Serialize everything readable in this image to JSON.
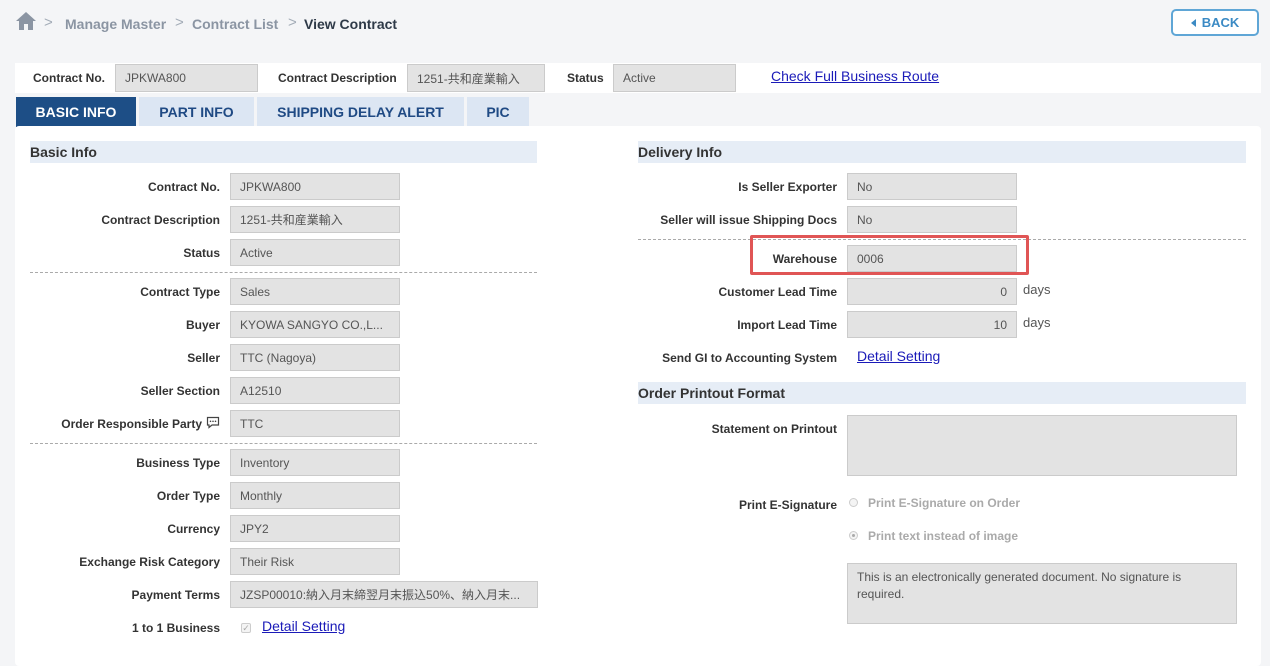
{
  "breadcrumb": {
    "items": [
      "Manage Master",
      "Contract List"
    ],
    "current": "View Contract",
    "separator": ">"
  },
  "back_button": "BACK",
  "header": {
    "contract_no_label": "Contract No.",
    "contract_no": "JPKWA800",
    "contract_desc_label": "Contract Description",
    "contract_desc": "1251-共和産業輸入",
    "status_label": "Status",
    "status": "Active",
    "route_link": "Check Full Business Route"
  },
  "tabs": [
    "BASIC INFO",
    "PART INFO",
    "SHIPPING DELAY ALERT",
    "PIC"
  ],
  "basic_info": {
    "title": "Basic Info",
    "fields": [
      {
        "label": "Contract No.",
        "value": "JPKWA800"
      },
      {
        "label": "Contract Description",
        "value": "1251-共和産業輸入"
      },
      {
        "label": "Status",
        "value": "Active"
      },
      {
        "label": "Contract Type",
        "value": "Sales"
      },
      {
        "label": "Buyer",
        "value": "KYOWA SANGYO CO.,L..."
      },
      {
        "label": "Seller",
        "value": "TTC (Nagoya)"
      },
      {
        "label": "Seller Section",
        "value": "A12510"
      },
      {
        "label": "Order Responsible Party",
        "value": "TTC"
      },
      {
        "label": "Business Type",
        "value": "Inventory"
      },
      {
        "label": "Order Type",
        "value": "Monthly"
      },
      {
        "label": "Currency",
        "value": "JPY2"
      },
      {
        "label": "Exchange Risk Category",
        "value": "Their Risk"
      },
      {
        "label": "Payment Terms",
        "value": "JZSP00010:納入月末締翌月末振込50%、納入月末..."
      }
    ],
    "one_to_one_label": "1 to 1 Business",
    "one_to_one_link": "Detail Setting"
  },
  "delivery_info": {
    "title": "Delivery Info",
    "is_seller_exporter_label": "Is Seller Exporter",
    "is_seller_exporter": "No",
    "seller_docs_label": "Seller will issue Shipping Docs",
    "seller_docs": "No",
    "warehouse_label": "Warehouse",
    "warehouse": "0006",
    "customer_lead_label": "Customer Lead Time",
    "customer_lead": "0",
    "import_lead_label": "Import Lead Time",
    "import_lead": "10",
    "days_unit": "days",
    "send_gi_label": "Send GI to Accounting System",
    "send_gi_link": "Detail Setting"
  },
  "order_printout": {
    "title": "Order Printout Format",
    "statement_label": "Statement on Printout",
    "statement": "",
    "esig_label": "Print E-Signature",
    "option_1": "Print E-Signature on Order",
    "option_2": "Print text instead of image",
    "selected_option": 2,
    "text_instead": "This is an electronically generated document. No signature is required."
  },
  "colors": {
    "tab_active": "#1d4e86",
    "tab_inactive": "#dce6f3",
    "highlight": "#e05555",
    "link": "#1a1ab8",
    "back_border": "#5fa6d6"
  }
}
